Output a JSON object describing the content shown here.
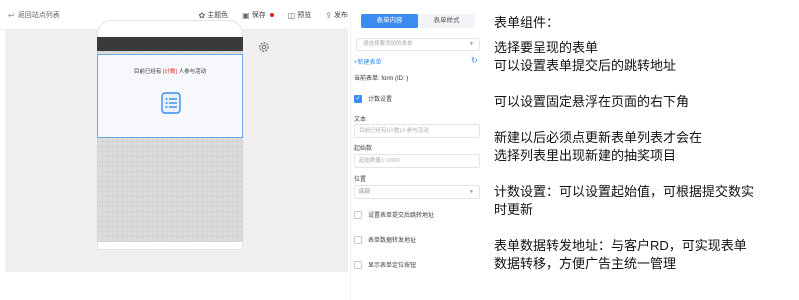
{
  "toolbar": {
    "back_label": "返回站点列表",
    "theme_label": "主题色",
    "save_label": "保存",
    "preview_label": "预览",
    "publish_label": "发布"
  },
  "canvas": {
    "count_prefix": "目前已经有",
    "count_token": "[计数]",
    "count_suffix": "人参与活动"
  },
  "panel": {
    "tabs": [
      {
        "label": "表单内容",
        "active": true
      },
      {
        "label": "表单样式",
        "active": false
      }
    ],
    "select_placeholder": "请选择要添加的表单",
    "new_form": "+新建表单",
    "current_form": "当前表单: form (ID: )",
    "count_setting": {
      "label": "计数设置",
      "checked": true
    },
    "text_label": "文本",
    "text_placeholder": "目前已经有{计数}人参与活动",
    "start_label": "起始数",
    "start_placeholder": "起始数量1~1000",
    "position_label": "位置",
    "position_value": "底部",
    "options": [
      {
        "label": "设置表单提交后跳转地址",
        "checked": false
      },
      {
        "label": "表单数据转发地址",
        "checked": false
      },
      {
        "label": "显示表单定位按钮",
        "checked": false
      }
    ]
  },
  "notes": {
    "title": "表单组件：",
    "line1": "选择要呈现的表单",
    "line2": "可以设置表单提交后的跳转地址",
    "line3": "可以设置固定悬浮在页面的右下角",
    "line4": "新建以后必须点更新表单列表才会在",
    "line5": "选择列表里出现新建的抽奖项目",
    "line6": "计数设置：可以设置起始值，可根据提交数实",
    "line7": "时更新",
    "line8": "表单数据转发地址：与客户RD，可实现表单",
    "line9": "数据转移，方便广告主统一管理"
  },
  "colors": {
    "accent": "#3a8cf0",
    "highlight": "#e02020",
    "phone_status": "#3a3a3a"
  },
  "icons": [
    "back-arrow-icon",
    "theme-icon",
    "save-icon",
    "preview-icon",
    "publish-icon",
    "form-icon",
    "gear-icon",
    "refresh-icon",
    "checkbox-icon",
    "caret-down-icon"
  ]
}
